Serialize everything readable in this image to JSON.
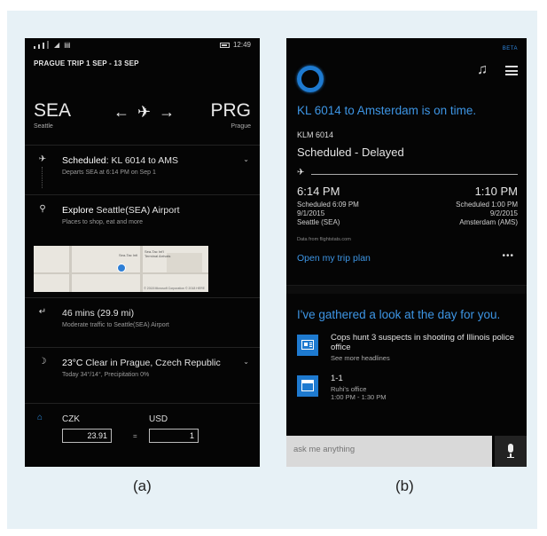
{
  "phone_a": {
    "status": {
      "time": "12:49"
    },
    "trip_title": "PRAGUE TRIP 1 SEP - 13 SEP",
    "route": {
      "from_code": "SEA",
      "from_city": "Seattle",
      "to_code": "PRG",
      "to_city": "Prague"
    },
    "rows": {
      "flight": {
        "prefix": "Scheduled:",
        "title": "KL 6014 to AMS",
        "sub": "Departs SEA at 6:14 PM on Sep 1"
      },
      "airport": {
        "prefix": "Explore",
        "title": "Seattle(SEA) Airport",
        "sub": "Places to shop, eat and more"
      },
      "traffic": {
        "title": "46 mins (29.9 mi)",
        "sub": "Moderate traffic to Seattle(SEA) Airport"
      },
      "weather": {
        "prefix": "23°C",
        "title": "Clear in Prague, Czech Republic",
        "sub": "Today 34°/14°, Precipitation 0%"
      }
    },
    "map": {
      "copyright": "© 2018 Microsoft Corporation © 2018 HERE",
      "label_a": "Sea-Tac Intl",
      "label_b": "Sea-Tac Int'l Terminal Arrivals"
    },
    "currency": {
      "from_label": "CZK",
      "to_label": "USD",
      "from_value": "23.91",
      "to_value": "1",
      "equals": "="
    }
  },
  "phone_b": {
    "beta": "BETA",
    "headline": "KL 6014 to Amsterdam is on time.",
    "flight_no": "KLM 6014",
    "flight_status": "Scheduled - Delayed",
    "departure": {
      "time": "6:14 PM",
      "scheduled": "Scheduled 6:09 PM",
      "date": "9/1/2015",
      "place": "Seattle (SEA)"
    },
    "arrival": {
      "time": "1:10 PM",
      "scheduled": "Scheduled 1:00 PM",
      "date": "9/2/2015",
      "place": "Amsterdam (AMS)"
    },
    "source": "Data from flightstats.com",
    "trip_plan": "Open my trip plan",
    "gathered": "I've gathered a look at the day for you.",
    "news": {
      "title": "Cops hunt 3 suspects in shooting of Illinois police office",
      "sub": "See more headlines"
    },
    "calendar": {
      "title": "1-1",
      "location": "Ruhi's office",
      "time": "1:00 PM - 1:30 PM"
    },
    "ask": {
      "placeholder": "ask me anything"
    }
  },
  "captions": {
    "a": "(a)",
    "b": "(b)"
  },
  "colors": {
    "accent": "#3d95e4",
    "tile": "#1e7ad0",
    "background": "#050505",
    "figure_bg": "#e7f1f6"
  }
}
